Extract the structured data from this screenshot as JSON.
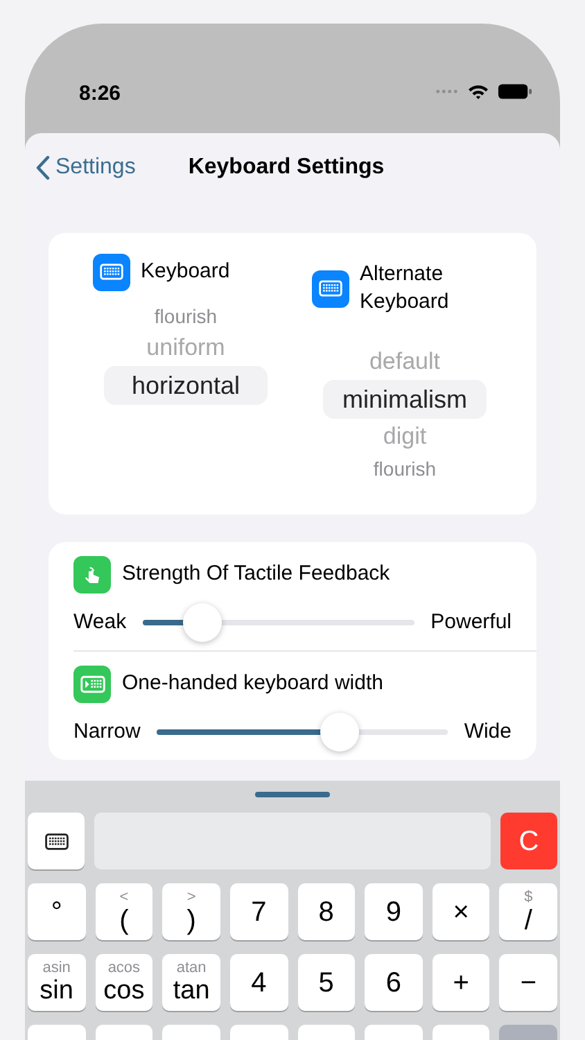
{
  "status_bar": {
    "time": "8:26"
  },
  "nav": {
    "back": "Settings",
    "title": "Keyboard Settings"
  },
  "pickers": [
    {
      "label": "Keyboard",
      "items": [
        {
          "label": "flourish",
          "selected": false
        },
        {
          "label": "uniform",
          "selected": false
        },
        {
          "label": "horizontal",
          "selected": true
        }
      ]
    },
    {
      "label": "Alternate Keyboard",
      "items": [
        {
          "label": "default",
          "selected": false
        },
        {
          "label": "minimalism",
          "selected": true
        },
        {
          "label": "digit",
          "selected": false
        },
        {
          "label": "flourish",
          "selected": false
        }
      ]
    }
  ],
  "settings": [
    {
      "kind": "tactile",
      "title": "Strength Of Tactile Feedback",
      "min_label": "Weak",
      "max_label": "Powerful",
      "level": 0.22
    },
    {
      "kind": "width",
      "title": "One-handed keyboard width",
      "min_label": "Narrow",
      "max_label": "Wide",
      "level": 0.63
    }
  ],
  "keypad": {
    "clear": "C",
    "rows": [
      [
        {
          "kind": "key",
          "main": "°"
        },
        {
          "kind": "key",
          "main": "(",
          "sub": "<"
        },
        {
          "kind": "key",
          "main": ")",
          "sub": ">"
        },
        {
          "kind": "key",
          "main": "7"
        },
        {
          "kind": "key",
          "main": "8"
        },
        {
          "kind": "key",
          "main": "9"
        },
        {
          "kind": "key",
          "main": "×"
        },
        {
          "kind": "key",
          "main": "/",
          "sub": "$"
        }
      ],
      [
        {
          "kind": "key",
          "main": "sin",
          "sub": "asin"
        },
        {
          "kind": "key",
          "main": "cos",
          "sub": "acos"
        },
        {
          "kind": "key",
          "main": "tan",
          "sub": "atan"
        },
        {
          "kind": "key",
          "main": "4"
        },
        {
          "kind": "key",
          "main": "5"
        },
        {
          "kind": "key",
          "main": "6"
        },
        {
          "kind": "key",
          "main": "+"
        },
        {
          "kind": "key",
          "main": "−"
        }
      ],
      [
        {
          "kind": "blank"
        },
        {
          "kind": "blank"
        },
        {
          "kind": "blank"
        },
        {
          "kind": "blank"
        },
        {
          "kind": "blank"
        },
        {
          "kind": "blank"
        },
        {
          "kind": "blank"
        },
        {
          "kind": "function"
        }
      ]
    ]
  }
}
